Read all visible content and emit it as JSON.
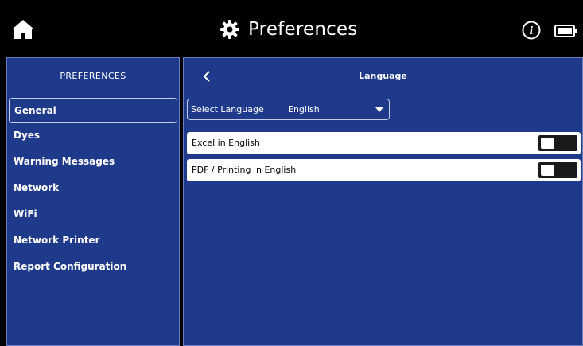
{
  "header": {
    "title": "Preferences",
    "icons": [
      "home-icon",
      "gear-icon",
      "info-icon",
      "battery-icon"
    ]
  },
  "sidebar": {
    "title": "PREFERENCES",
    "items": [
      {
        "label": "General",
        "active": true
      },
      {
        "label": "Dyes"
      },
      {
        "label": "Warning Messages"
      },
      {
        "label": "Network"
      },
      {
        "label": "WiFi"
      },
      {
        "label": "Network Printer"
      },
      {
        "label": "Report Configuration"
      }
    ]
  },
  "content": {
    "title": "Language",
    "select": {
      "label": "Select Language",
      "value": "English"
    },
    "toggles": [
      {
        "label": "Excel in English",
        "on": false
      },
      {
        "label": "PDF / Printing in English",
        "on": false
      }
    ]
  },
  "colors": {
    "topbar": "#000000",
    "panel": "#1f3a8a",
    "row": "#ffffff",
    "toggle": "#1a1a1a"
  }
}
